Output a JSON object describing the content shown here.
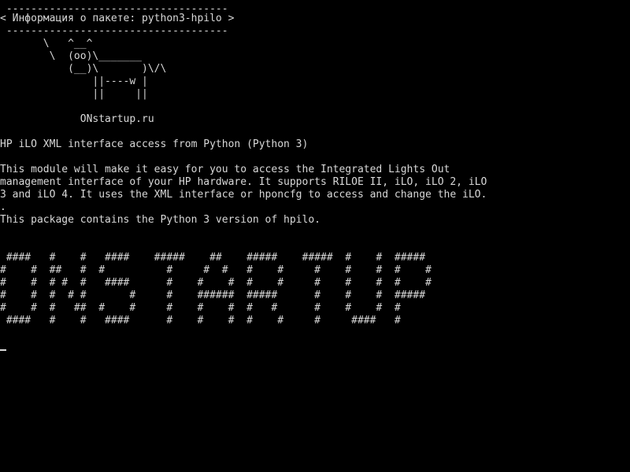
{
  "cowsay": {
    "border_top": " ------------------------------------",
    "bubble": "< Информация о пакете: python3-hpilo >",
    "border_bottom": " ------------------------------------",
    "cow": [
      "       \\   ^__^",
      "        \\  (oo)\\_______",
      "           (__)\\       )\\/\\",
      "               ||----w |",
      "               ||     ||"
    ]
  },
  "site_label": "             ONstartup.ru",
  "package": {
    "summary": "HP iLO XML interface access from Python (Python 3)",
    "description": [
      "This module will make it easy for you to access the Integrated Lights Out",
      "management interface of your HP hardware. It supports RILOE II, iLO, iLO 2, iLO",
      "3 and iLO 4. It uses the XML interface or hponcfg to access and change the iLO.",
      ".",
      "This package contains the Python 3 version of hpilo."
    ]
  },
  "banner": [
    " ####   #    #   ####    #####    ##    #####    #####  #    #  #####",
    "#    #  ##   #  #          #     #  #   #    #     #    #    #  #    #",
    "#    #  # #  #   ####      #    #    #  #    #     #    #    #  #    #",
    "#    #  #  # #       #     #    ######  #####      #    #    #  #####",
    "#    #  #   ##  #    #     #    #    #  #   #      #    #    #  #",
    " ####   #    #   ####      #    #    #  #    #     #     ####   #"
  ]
}
